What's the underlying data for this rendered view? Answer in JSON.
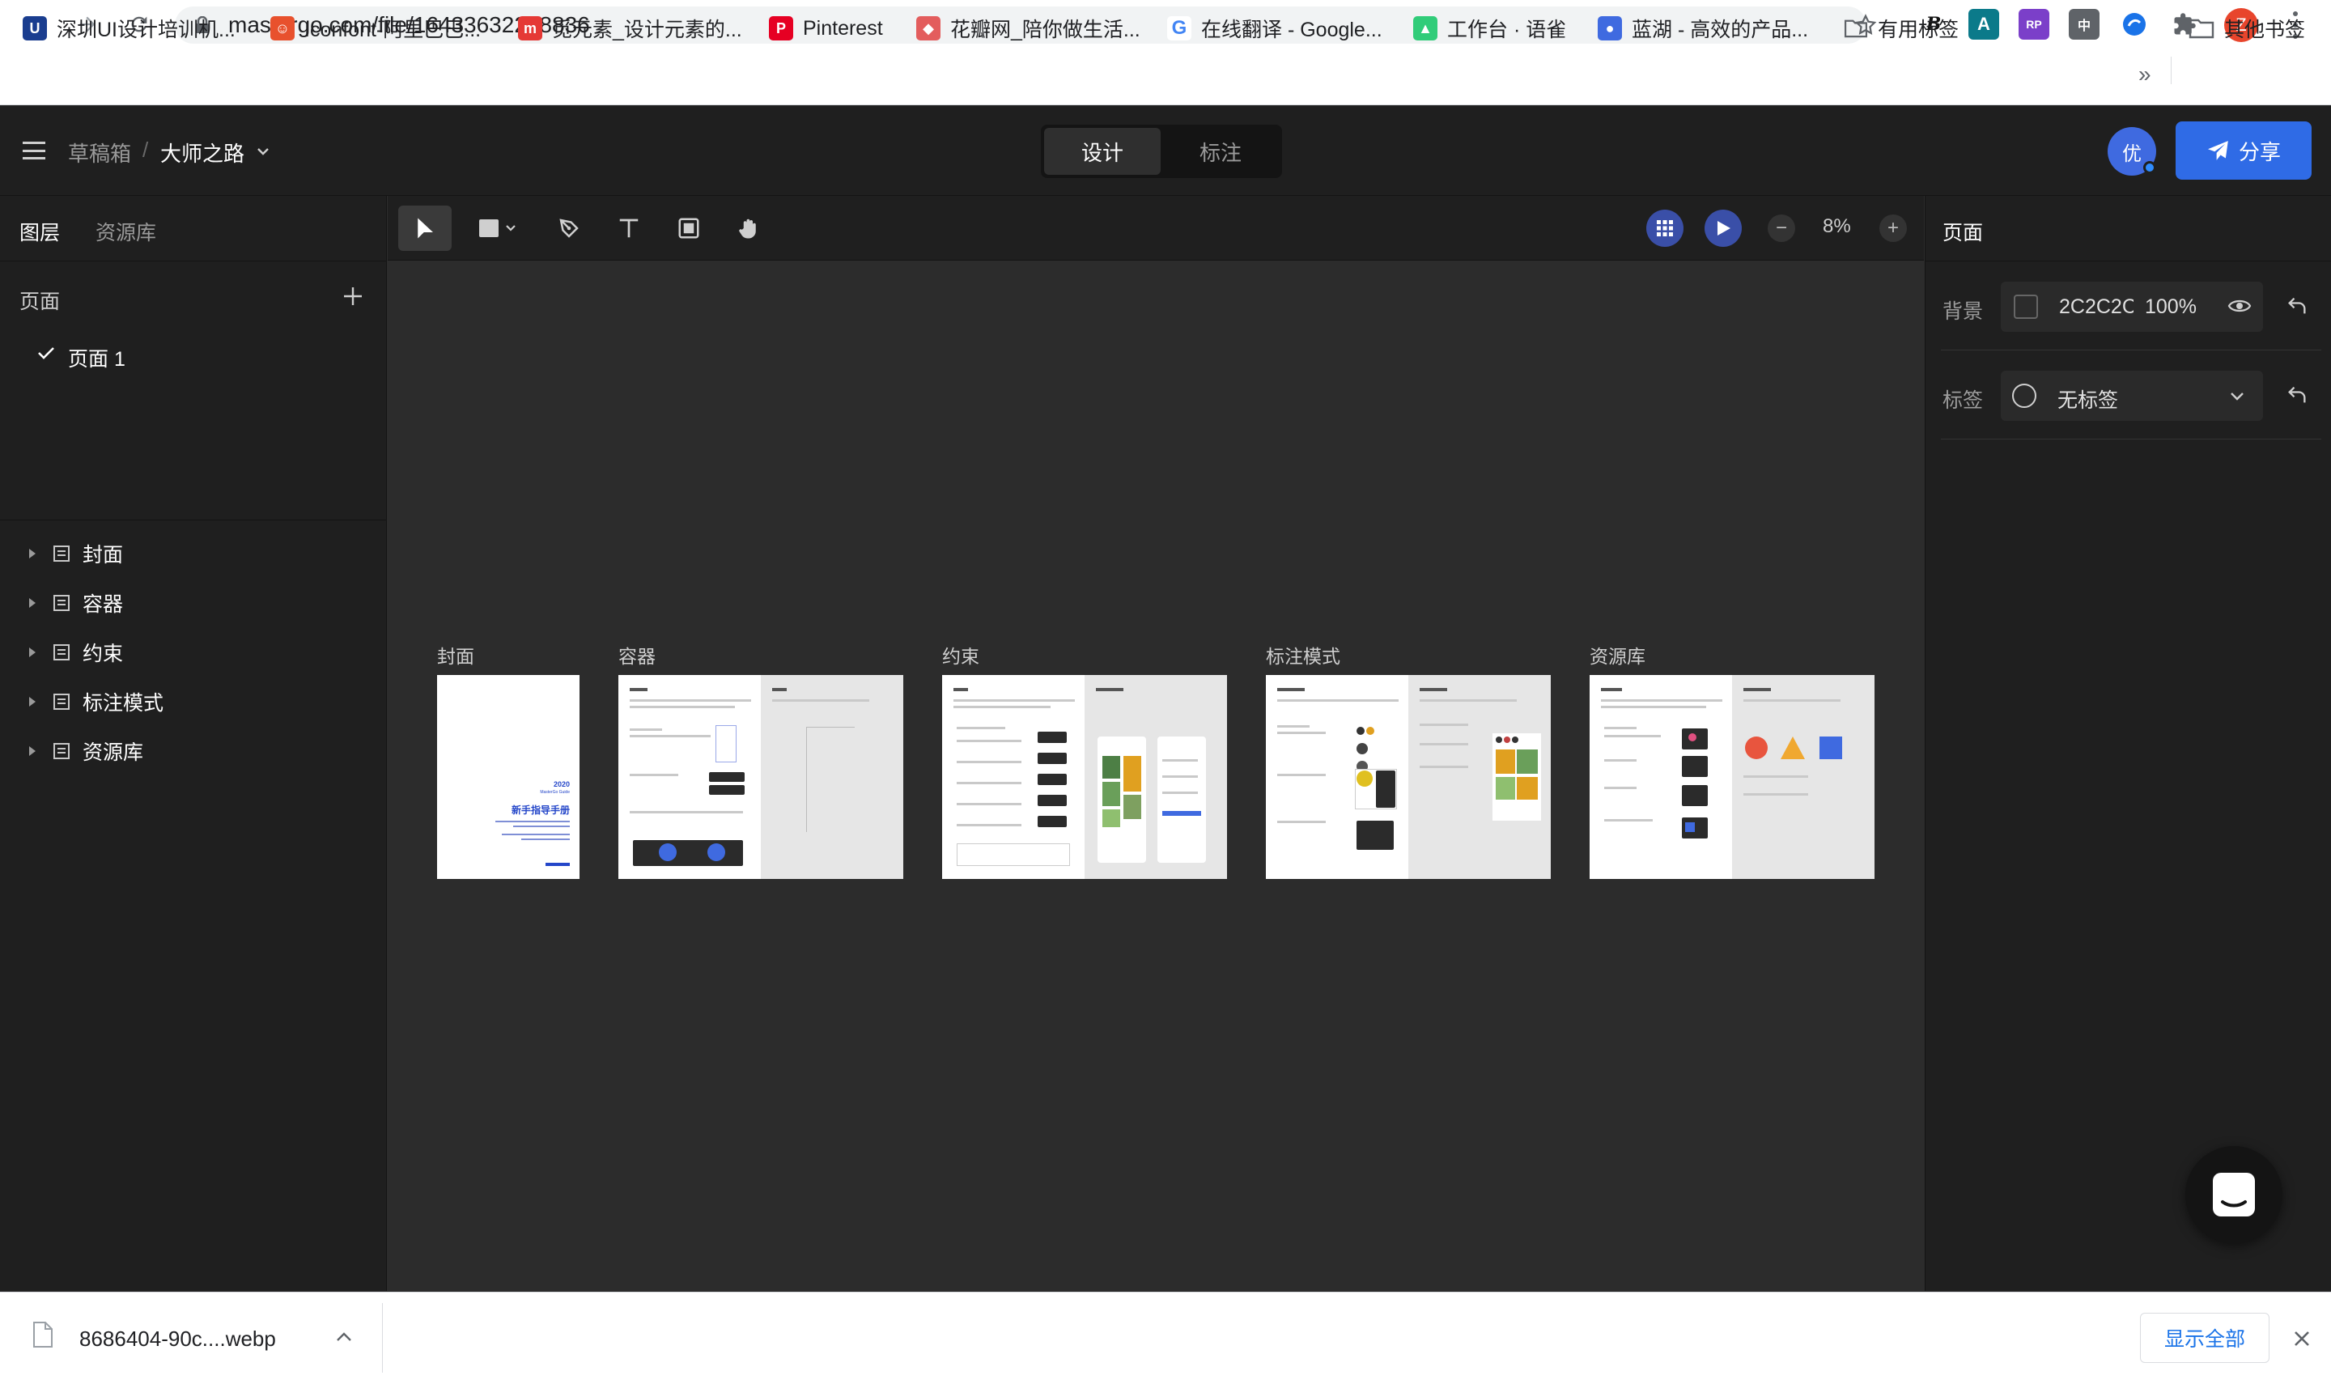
{
  "browser": {
    "url": "mastergo.com/file/16433632258836",
    "nav": {
      "back_icon": "arrow-left-icon",
      "forward_icon": "arrow-right-icon",
      "reload_icon": "reload-icon"
    },
    "profile_initial": "Z",
    "bookmarks": [
      {
        "label": "深圳UI设计培训机...",
        "icon": "u-logo",
        "color": "#1a3d8f"
      },
      {
        "label": "Iconfont-阿里巴巴...",
        "icon": "iconfont-logo",
        "color": "#e8512d"
      },
      {
        "label": "觅元素_设计元素的...",
        "icon": "mi-logo",
        "color": "#e53935"
      },
      {
        "label": "Pinterest",
        "icon": "pinterest-logo",
        "color": "#e60023"
      },
      {
        "label": "花瓣网_陪你做生活...",
        "icon": "huaban-logo",
        "color": "#e35d5d"
      },
      {
        "label": "在线翻译 - Google...",
        "icon": "google-logo",
        "color": "#4285f4"
      },
      {
        "label": "工作台 · 语雀",
        "icon": "yuque-logo",
        "color": "#31cc79"
      },
      {
        "label": "蓝湖 - 高效的产品...",
        "icon": "lanhu-logo",
        "color": "#3f6ae0"
      },
      {
        "label": "有用标签",
        "icon": "folder-icon",
        "color": "#5f6368"
      }
    ],
    "more_bookmarks": "»",
    "other_bookmarks": "其他书签"
  },
  "app": {
    "breadcrumb": {
      "root": "草稿箱",
      "separator": "/",
      "file": "大师之路"
    },
    "mode_tabs": [
      {
        "label": "设计",
        "active": true
      },
      {
        "label": "标注",
        "active": false
      }
    ],
    "avatar": "优",
    "share_label": "分享"
  },
  "left_panel": {
    "tabs": [
      {
        "label": "图层",
        "active": true
      },
      {
        "label": "资源库",
        "active": false
      }
    ],
    "pages_header": "页面",
    "pages": [
      {
        "label": "页面 1",
        "selected": true
      }
    ],
    "layers": [
      {
        "label": "封面"
      },
      {
        "label": "容器"
      },
      {
        "label": "约束"
      },
      {
        "label": "标注模式"
      },
      {
        "label": "资源库"
      }
    ]
  },
  "toolbar": {
    "zoom": "8%",
    "zoom_out": "−",
    "zoom_in": "+"
  },
  "canvas": {
    "frames": [
      {
        "label": "封面"
      },
      {
        "label": "容器"
      },
      {
        "label": "约束"
      },
      {
        "label": "标注模式"
      },
      {
        "label": "资源库"
      }
    ],
    "cover": {
      "year": "2020",
      "subtitle": "MasterGo Guide",
      "title": "新手指导手册"
    }
  },
  "right_panel": {
    "title": "页面",
    "background_label": "背景",
    "background_hex": "2C2C2C",
    "background_opacity": "100%",
    "tag_label": "标签",
    "tag_value": "无标签"
  },
  "download_shelf": {
    "filename": "8686404-90c....webp",
    "show_all": "显示全部"
  },
  "colors": {
    "accent": "#2f6be6",
    "canvas_bg": "#2c2c2c",
    "panel_bg": "#1f1f1f"
  }
}
